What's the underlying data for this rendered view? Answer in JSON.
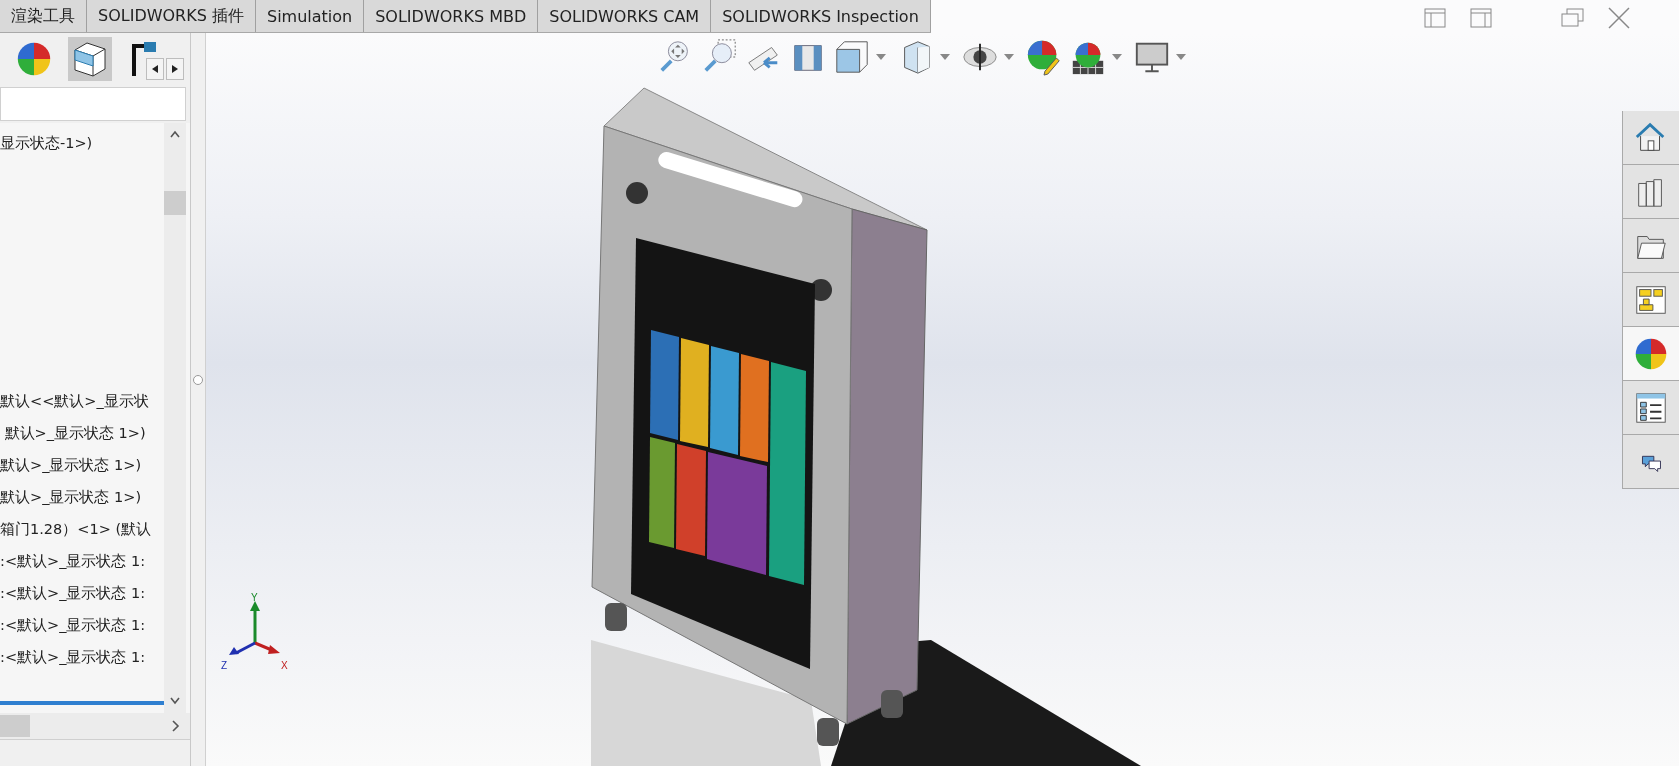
{
  "tabs": [
    {
      "label": "渲染工具"
    },
    {
      "label": "SOLIDWORKS 插件"
    },
    {
      "label": "Simulation"
    },
    {
      "label": "SOLIDWORKS MBD"
    },
    {
      "label": "SOLIDWORKS CAM"
    },
    {
      "label": "SOLIDWORKS Inspection"
    }
  ],
  "feature_tree": {
    "items": [
      {
        "label": "显示状态-1>)"
      },
      {
        "label": "默认<<默认>_显示状"
      },
      {
        "label": " 默认>_显示状态 1>)"
      },
      {
        "label": "默认>_显示状态 1>)"
      },
      {
        "label": "默认>_显示状态 1>)"
      },
      {
        "label": "箱门1.28）<1> (默认"
      },
      {
        "label": ":<默认>_显示状态 1:"
      },
      {
        "label": ":<默认>_显示状态 1:"
      },
      {
        "label": ":<默认>_显示状态 1:"
      },
      {
        "label": ":<默认>_显示状态 1:"
      }
    ]
  },
  "task_pane": {
    "tabs": [
      {
        "selected": false
      },
      {
        "selected": false
      },
      {
        "selected": false
      },
      {
        "selected": false
      },
      {
        "selected": true
      },
      {
        "selected": false
      },
      {
        "selected": false
      }
    ]
  },
  "triad": {
    "x_label": "X",
    "y_label": "Y",
    "z_label": "Z"
  }
}
